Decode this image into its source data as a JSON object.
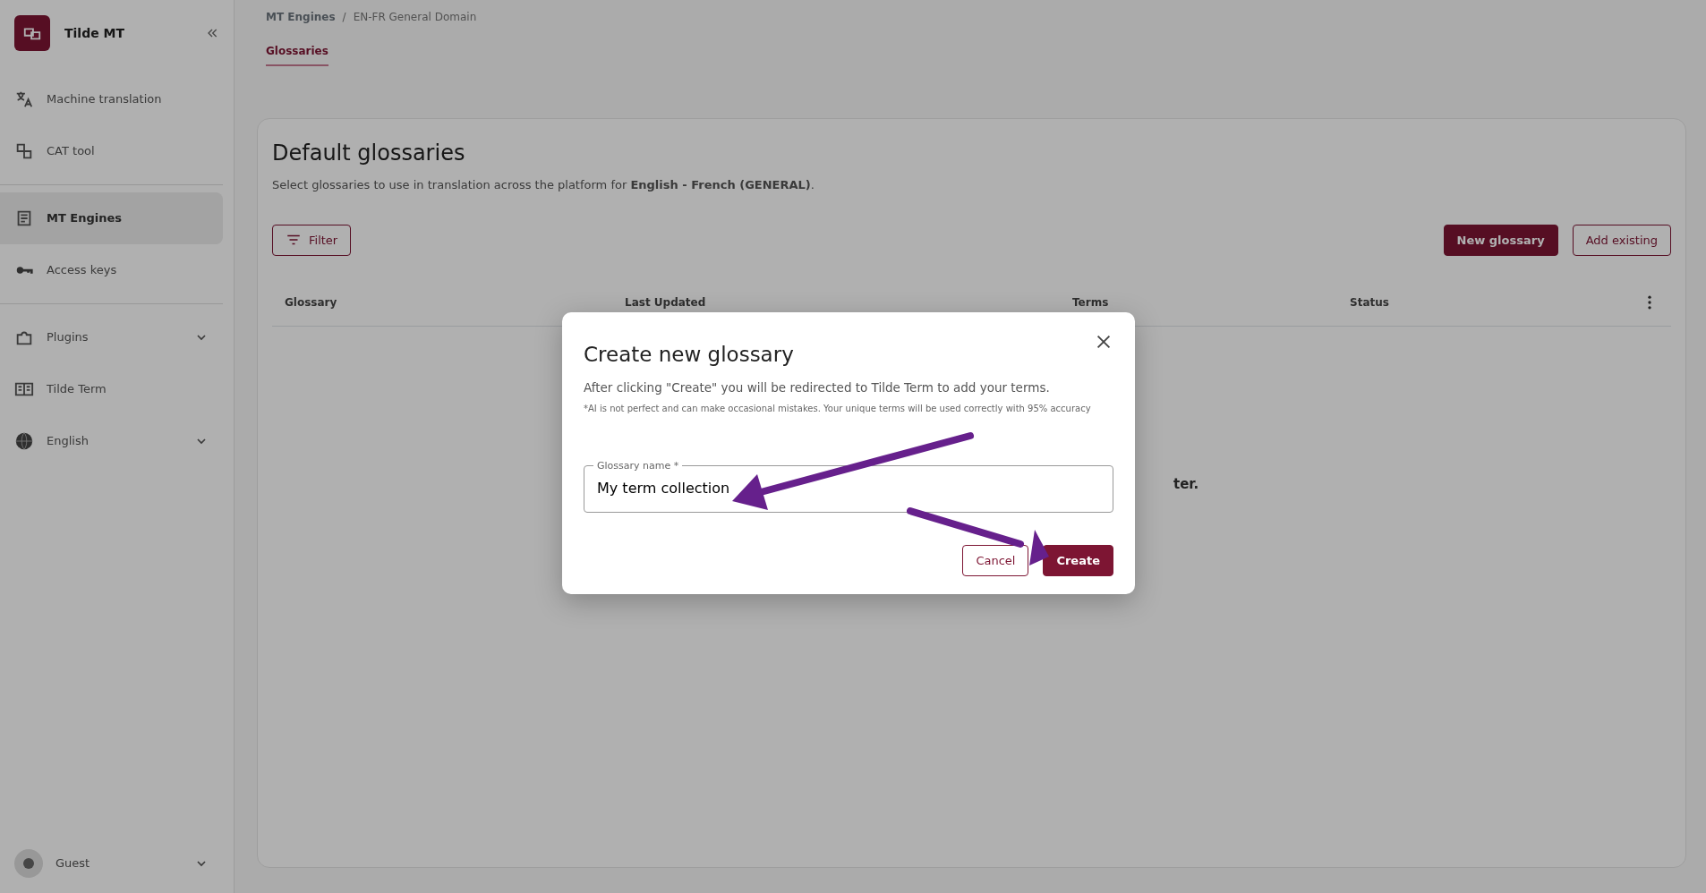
{
  "sidebar": {
    "app_name": "Tilde MT",
    "groups": [
      [
        {
          "label": "Machine translation",
          "selected": false,
          "has_submenu": false
        },
        {
          "label": "CAT tool",
          "selected": false,
          "has_submenu": false
        }
      ],
      [
        {
          "label": "MT Engines",
          "selected": true,
          "has_submenu": false
        },
        {
          "label": "Access keys",
          "selected": false,
          "has_submenu": false
        }
      ],
      [
        {
          "label": "Plugins",
          "selected": false,
          "has_submenu": true
        },
        {
          "label": "Tilde Term",
          "selected": false,
          "has_submenu": false
        },
        {
          "label": "English",
          "selected": false,
          "has_submenu": true
        }
      ]
    ],
    "user": {
      "name": "Guest"
    }
  },
  "breadcrumb": {
    "items": [
      "MT Engines",
      "EN-FR General Domain"
    ],
    "separator": "/"
  },
  "tabs": [
    {
      "label": "Glossaries",
      "selected": true
    }
  ],
  "card": {
    "title": "Default glossaries",
    "description": "Select glossaries to use in translation across the platform for **English - French (GENERAL)**.",
    "filter_button": "Filter",
    "buttons": [
      {
        "label": "New glossary",
        "kind": "primary"
      },
      {
        "label": "Add existing",
        "kind": "secondary"
      }
    ],
    "columns": [
      "Glossary",
      "Last Updated",
      "Terms",
      "Status"
    ],
    "empty_text": "ter."
  },
  "dialog": {
    "title": "Create new glossary",
    "text": "After clicking \"Create\" you will be redirected to Tilde Term to add your terms.",
    "note": "*AI is not perfect and can make occasional mistakes. Your unique terms will be used correctly with 95% accuracy",
    "field": {
      "label": "Glossary name *",
      "value": "My term collection"
    },
    "buttons": [
      {
        "label": "Cancel",
        "kind": "secondary"
      },
      {
        "label": "Create",
        "kind": "primary"
      }
    ]
  }
}
